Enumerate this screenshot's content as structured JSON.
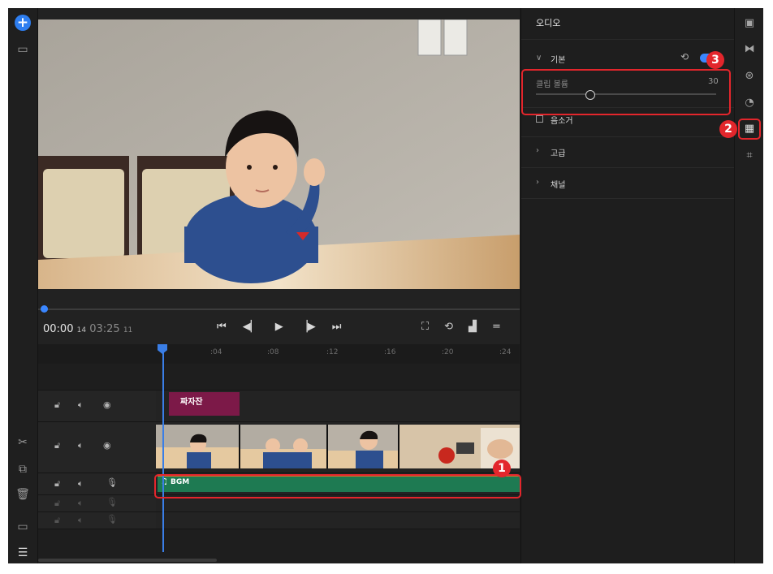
{
  "right_panel": {
    "title": "오디오",
    "section_basic": "기본",
    "clip_volume_label": "클립 볼륨",
    "clip_volume_value": "30",
    "clip_volume_fraction": 0.3,
    "mute_label": "음소거",
    "section_advanced": "고급",
    "section_channel": "채널"
  },
  "transport": {
    "current_time": "00:00",
    "current_frames": "14",
    "total_time": "03:25",
    "total_frames": "11"
  },
  "ruler_ticks": [
    ":04",
    ":08",
    ":12",
    ":16",
    ":20",
    ":24"
  ],
  "timeline": {
    "title_clip_label": "짜자잔",
    "audio_clip_label": "BGM"
  },
  "annotations": {
    "badge_1": "1",
    "badge_2": "2",
    "badge_3": "3"
  },
  "colors": {
    "accent": "#3a86ff",
    "title_clip": "#7c1948",
    "audio_clip": "#1e7a52",
    "highlight": "#e3262c"
  }
}
